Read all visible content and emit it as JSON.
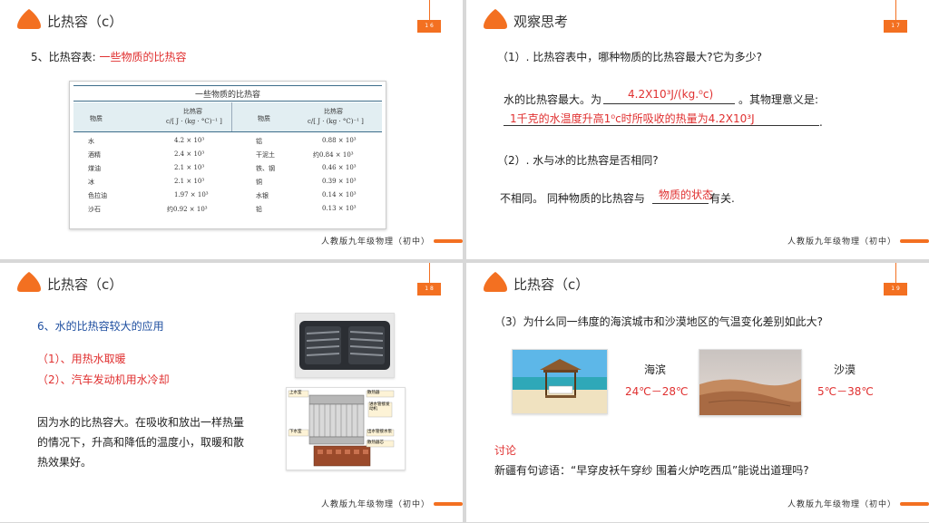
{
  "s1": {
    "title": "比热容（c）",
    "page_num": "1 6",
    "heading_prefix": "5、比热容表:",
    "heading_red": "一些物质的比热容",
    "table": {
      "title": "一些物质的比热容",
      "h_substance": "物质",
      "h_c_line1": "比热容",
      "h_c_line2": "c/[ J · (kg · °C)⁻¹ ]",
      "rows": [
        [
          "水",
          "4.2 × 10³",
          "铝",
          "0.88 × 10³"
        ],
        [
          "酒精",
          "2.4 × 10³",
          "干泥土",
          "约0.84 × 10³"
        ],
        [
          "煤油",
          "2.1 × 10³",
          "铁、钢",
          "0.46 × 10³"
        ],
        [
          "冰",
          "2.1 × 10³",
          "铜",
          "0.39 × 10³"
        ],
        [
          "色拉油",
          "1.97 × 10³",
          "水银",
          "0.14 × 10³"
        ],
        [
          "沙石",
          "约0.92 × 10³",
          "铅",
          "0.13 × 10³"
        ]
      ]
    },
    "footer": "人教版九年级物理（初中）"
  },
  "s2": {
    "title": "观察思考",
    "page_num": "1 7",
    "q1": "（1）. 比热容表中，哪种物质的比热容最大?它为多少?",
    "ans1_prefix": "水的比热容最大。为",
    "ans1_fill": "4.2X10³J/(kg.⁰c)",
    "ans1_suffix": "。其物理意义是:",
    "ans1_meaning": "1千克的水温度升高1⁰c时所吸收的热量为4.2X10³J",
    "q2": "（2）. 水与冰的比热容是否相同?",
    "ans2_prefix": "不相同。 同种物质的比热容与",
    "ans2_fill": "物质的状态",
    "ans2_suffix": "有关.",
    "footer": "人教版九年级物理（初中）"
  },
  "s3": {
    "title": "比热容（c）",
    "page_num": "1 8",
    "heading": "6、水的比热容较大的应用",
    "item1": "（1）、用热水取暖",
    "item2": "（2）、汽车发动机用水冷却",
    "para_line1": "因为水的比热容大。在吸收和放出一样热量",
    "para_line2": "的情况下，升高和降低的温度小，取暖和散",
    "para_line3": "热效果好。",
    "diagram_labels": [
      "上水室",
      "散热器",
      "进水管接发动机",
      "下水室",
      "出水管接水泵",
      "散热器芯"
    ],
    "footer": "人教版九年级物理（初中）"
  },
  "s4": {
    "title": "比热容（c）",
    "page_num": "1 9",
    "q3": "（3）为什么同一纬度的海滨城市和沙漠地区的气温变化差别如此大?",
    "coast_label": "海滨",
    "coast_temp": "24℃－28℃",
    "desert_label": "沙漠",
    "desert_temp": "5℃－38℃",
    "discuss": "讨论",
    "proverb": "新疆有句谚语：“早穿皮袄午穿纱 围着火炉吃西瓜”能说出道理吗?",
    "footer": "人教版九年级物理（初中）"
  },
  "colors": {
    "accent": "#f37021",
    "red": "#e03030",
    "blue": "#1f4fa0"
  }
}
